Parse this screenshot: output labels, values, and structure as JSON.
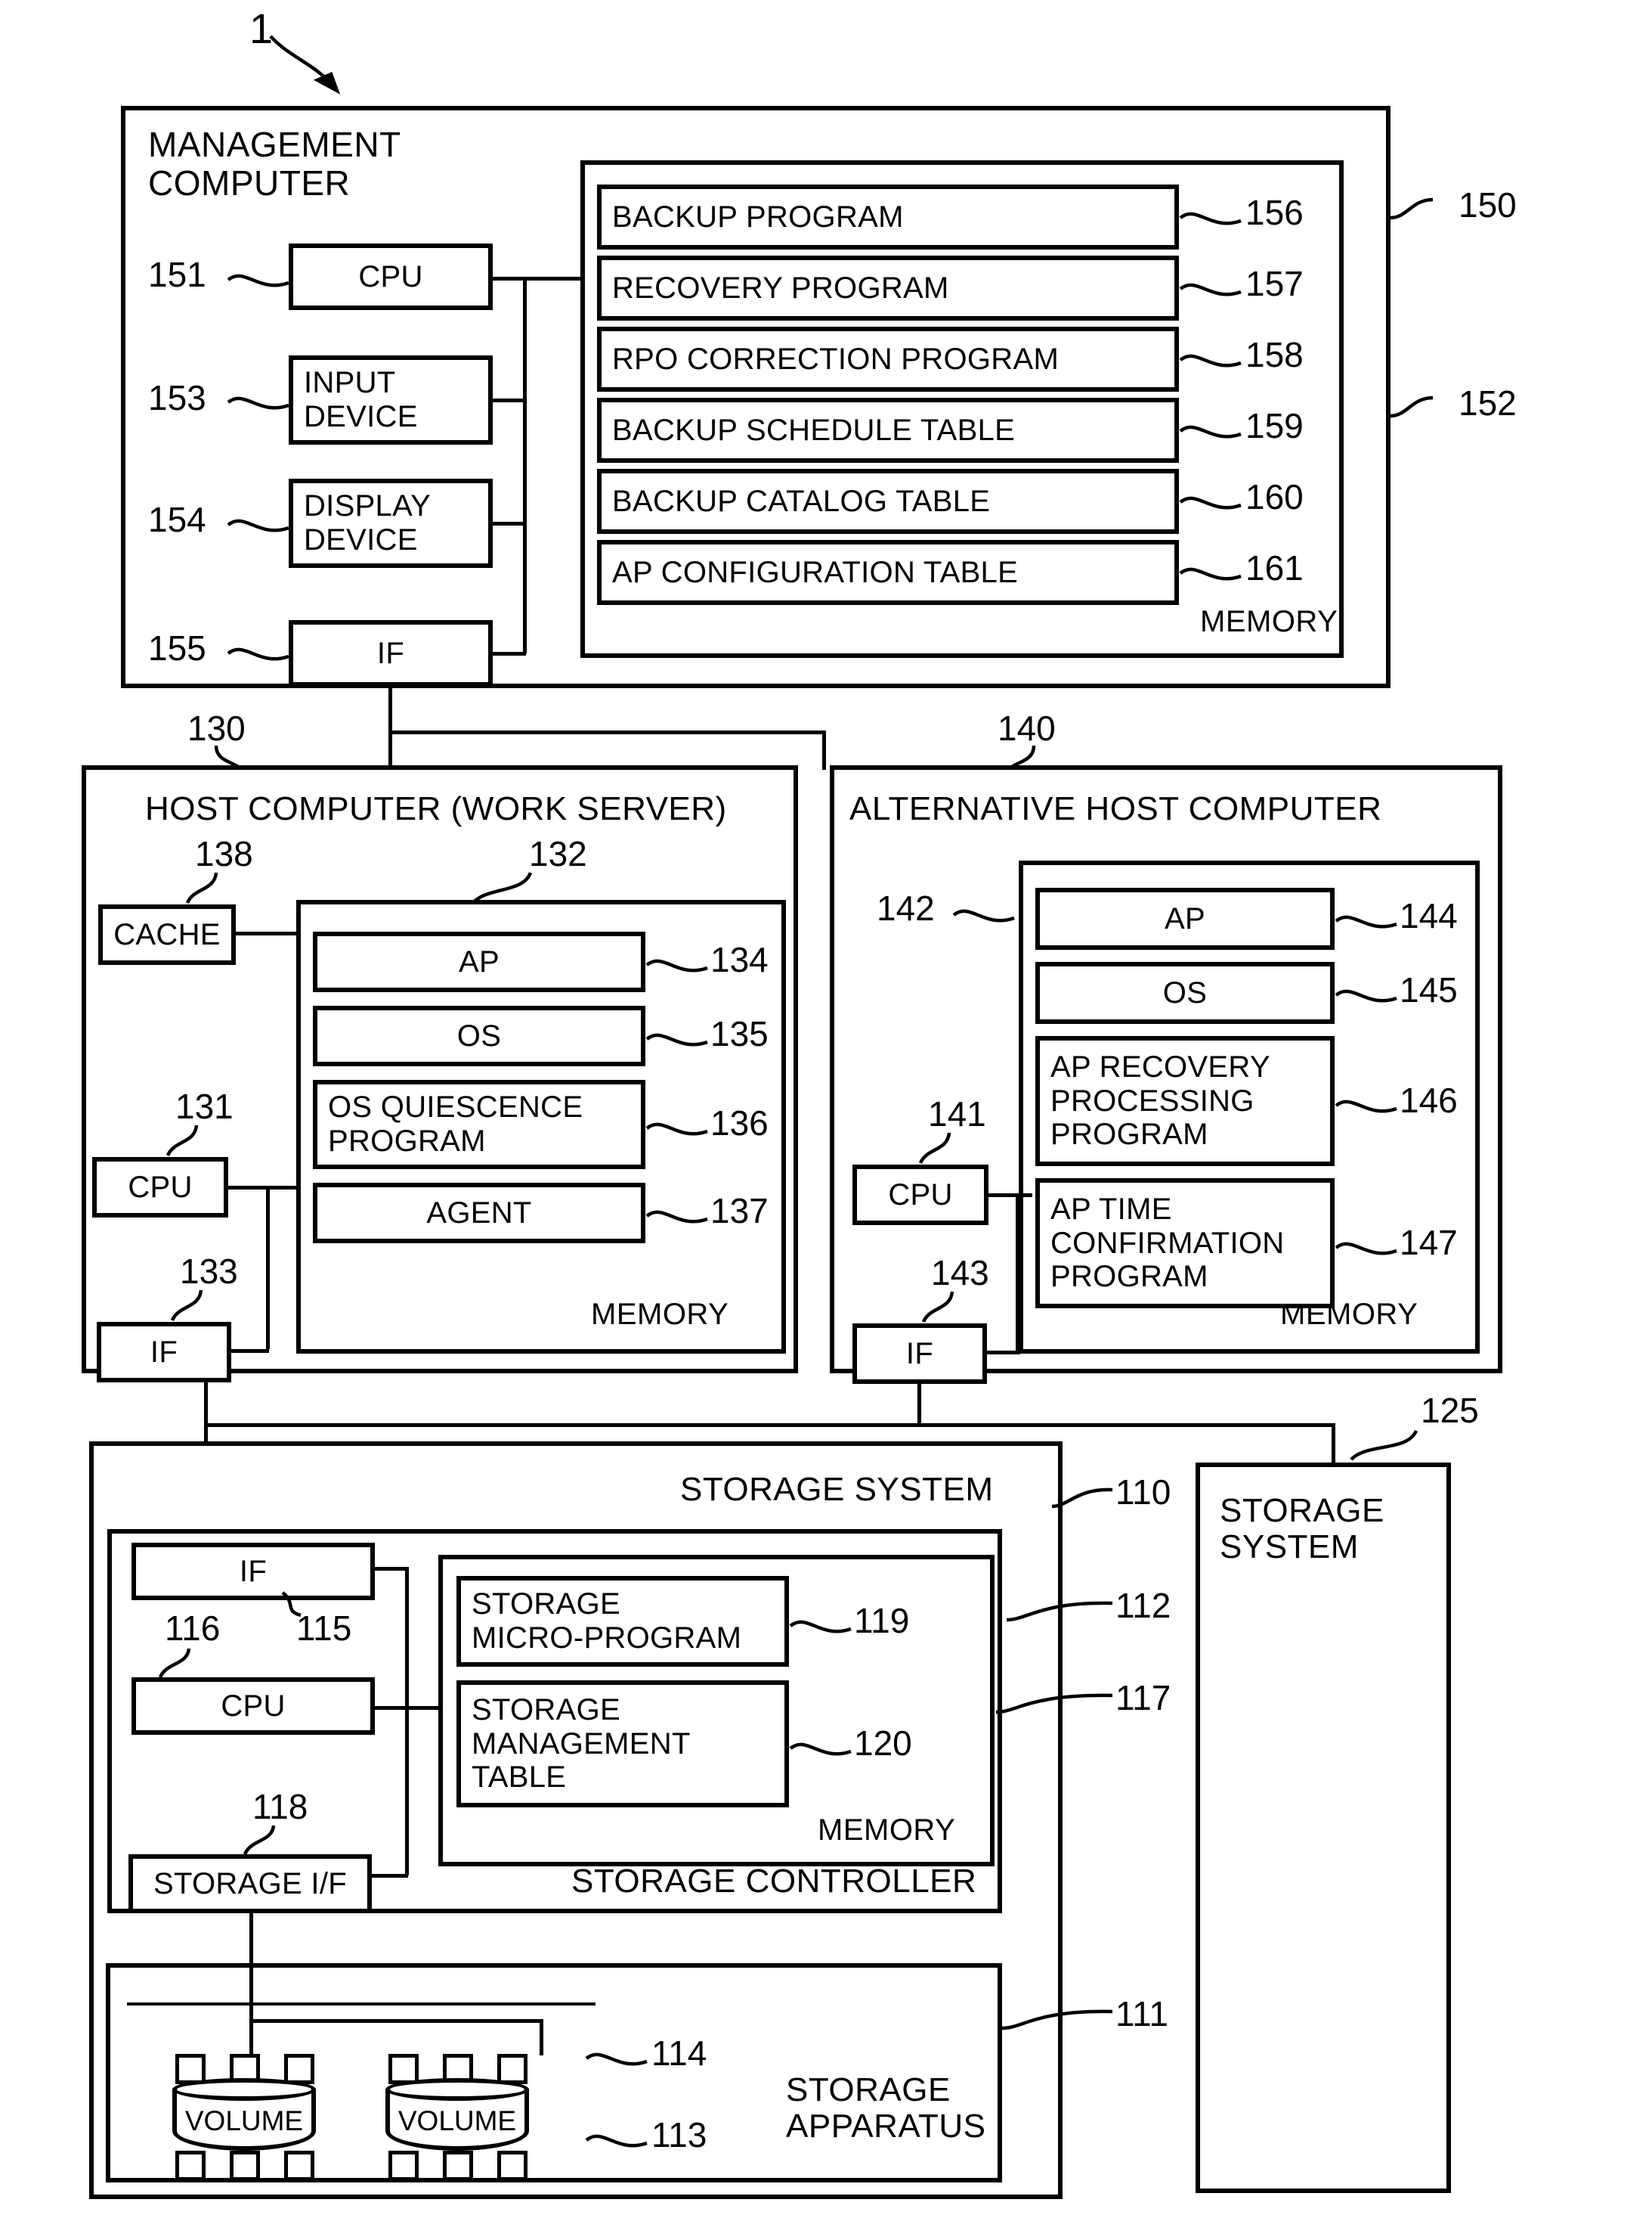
{
  "figure": {
    "system_ref": "1"
  },
  "management_computer": {
    "title": "MANAGEMENT\nCOMPUTER",
    "ref": "150",
    "cpu": {
      "label": "CPU",
      "ref": "151"
    },
    "input_device": {
      "label": "INPUT\nDEVICE",
      "ref": "153"
    },
    "display_device": {
      "label": "DISPLAY\nDEVICE",
      "ref": "154"
    },
    "interface": {
      "label": "IF",
      "ref": "155"
    },
    "memory": {
      "label": "MEMORY",
      "ref": "152",
      "items": [
        {
          "label": "BACKUP PROGRAM",
          "ref": "156"
        },
        {
          "label": "RECOVERY PROGRAM",
          "ref": "157"
        },
        {
          "label": "RPO CORRECTION PROGRAM",
          "ref": "158"
        },
        {
          "label": "BACKUP SCHEDULE TABLE",
          "ref": "159"
        },
        {
          "label": "BACKUP CATALOG TABLE",
          "ref": "160"
        },
        {
          "label": "AP CONFIGURATION TABLE",
          "ref": "161"
        }
      ]
    }
  },
  "host_computer": {
    "title": "HOST COMPUTER (WORK SERVER)",
    "ref": "130",
    "cache": {
      "label": "CACHE",
      "ref": "138"
    },
    "cpu": {
      "label": "CPU",
      "ref": "131"
    },
    "interface": {
      "label": "IF",
      "ref": "133"
    },
    "memory": {
      "label": "MEMORY",
      "ref": "132",
      "items": [
        {
          "label": "AP",
          "ref": "134"
        },
        {
          "label": "OS",
          "ref": "135"
        },
        {
          "label": "OS QUIESCENCE\nPROGRAM",
          "ref": "136"
        },
        {
          "label": "AGENT",
          "ref": "137"
        }
      ]
    }
  },
  "alternative_host_computer": {
    "title": "ALTERNATIVE HOST COMPUTER",
    "ref": "140",
    "cpu": {
      "label": "CPU",
      "ref": "141"
    },
    "interface": {
      "label": "IF",
      "ref": "143"
    },
    "memory": {
      "label": "MEMORY",
      "ref": "142",
      "items": [
        {
          "label": "AP",
          "ref": "144"
        },
        {
          "label": "OS",
          "ref": "145"
        },
        {
          "label": "AP RECOVERY\nPROCESSING\nPROGRAM",
          "ref": "146"
        },
        {
          "label": "AP TIME\nCONFIRMATION\nPROGRAM",
          "ref": "147"
        }
      ]
    }
  },
  "storage_system": {
    "title": "STORAGE SYSTEM",
    "ref": "110",
    "controller": {
      "label": "STORAGE CONTROLLER",
      "ref": "112",
      "interface": {
        "label": "IF",
        "ref": "115"
      },
      "cpu": {
        "label": "CPU",
        "ref": "116"
      },
      "storage_if": {
        "label": "STORAGE I/F",
        "ref": "118"
      },
      "memory": {
        "label": "MEMORY",
        "ref": "117",
        "items": [
          {
            "label": "STORAGE\nMICRO-PROGRAM",
            "ref": "119"
          },
          {
            "label": "STORAGE\nMANAGEMENT\nTABLE",
            "ref": "120"
          }
        ]
      }
    },
    "apparatus": {
      "label": "STORAGE\nAPPARATUS",
      "ref": "111",
      "volumes": [
        {
          "label": "VOLUME",
          "ref": "114"
        },
        {
          "label": "VOLUME",
          "ref": "113"
        }
      ]
    }
  },
  "secondary_storage_system": {
    "title": "STORAGE\nSYSTEM",
    "ref": "125"
  }
}
